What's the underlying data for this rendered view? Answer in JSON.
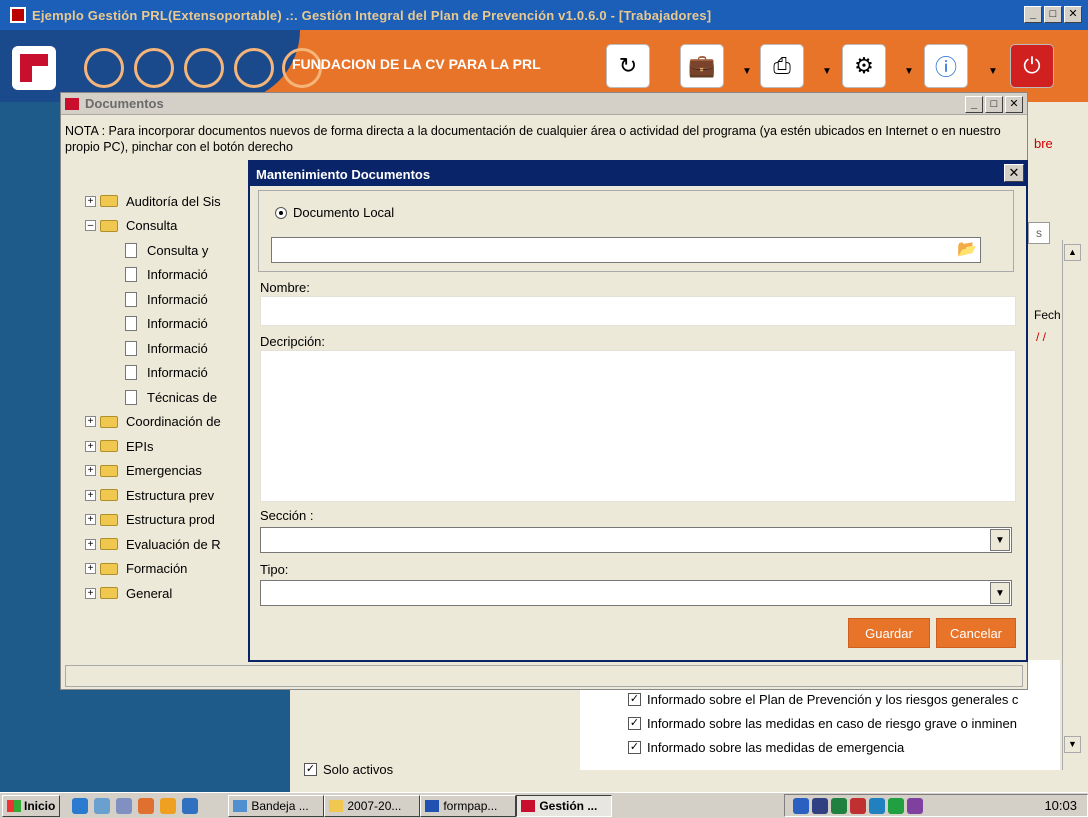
{
  "main_window": {
    "title": "Ejemplo Gestión PRL(Extensoportable) .:. Gestión Integral del Plan de Prevención v1.0.6.0 - [Trabajadores]",
    "organization": "FUNDACION DE LA CV PARA LA PRL",
    "brand_color": "#e8742a"
  },
  "background": {
    "right_label_fragment": "bre",
    "tab_fragment": "s",
    "col_fragment": "Fech",
    "date_fragment": "/ /",
    "checks": [
      "Informado sobre el Plan de Prevención y los riesgos generales c",
      "Informado sobre las medidas en caso de riesgo grave o inminen",
      "Informado sobre las medidas de emergencia"
    ],
    "solo_activos": "Solo activos"
  },
  "documentos": {
    "title": "Documentos",
    "nota": "NOTA : Para incorporar documentos nuevos de forma directa a la documentación de cualquier área o actividad del programa (ya estén ubicados en Internet o en nuestro propio PC), pinchar con el botón derecho",
    "tree": [
      {
        "label": "Auditoría del Sis",
        "type": "folder",
        "expanded": false
      },
      {
        "label": "Consulta",
        "type": "folder",
        "expanded": true
      },
      {
        "label": "Consulta y",
        "type": "doc"
      },
      {
        "label": "Informació",
        "type": "doc"
      },
      {
        "label": "Informació",
        "type": "doc"
      },
      {
        "label": "Informació",
        "type": "doc"
      },
      {
        "label": "Informació",
        "type": "doc"
      },
      {
        "label": "Informació",
        "type": "doc"
      },
      {
        "label": "Técnicas de",
        "type": "doc"
      },
      {
        "label": "Coordinación de",
        "type": "folder",
        "expanded": false
      },
      {
        "label": "EPIs",
        "type": "folder",
        "expanded": false
      },
      {
        "label": "Emergencias",
        "type": "folder",
        "expanded": false
      },
      {
        "label": "Estructura prev",
        "type": "folder",
        "expanded": false
      },
      {
        "label": "Estructura prod",
        "type": "folder",
        "expanded": false
      },
      {
        "label": "Evaluación de R",
        "type": "folder",
        "expanded": false
      },
      {
        "label": "Formación",
        "type": "folder",
        "expanded": false
      },
      {
        "label": "General",
        "type": "folder",
        "expanded": false
      }
    ]
  },
  "dialog": {
    "title": "Mantenimiento Documentos",
    "radio_label": "Documento Local",
    "path_value": "",
    "nombre_label": "Nombre:",
    "nombre_value": "",
    "descripcion_label": "Decripción:",
    "descripcion_value": "",
    "seccion_label": "Sección :",
    "seccion_value": "",
    "tipo_label": "Tipo:",
    "tipo_value": "",
    "save_label": "Guardar",
    "cancel_label": "Cancelar"
  },
  "taskbar": {
    "start_label": "Inicio",
    "tasks": [
      "Bandeja ...",
      "2007-20...",
      "formpap...",
      "Gestión ..."
    ],
    "clock": "10:03"
  }
}
